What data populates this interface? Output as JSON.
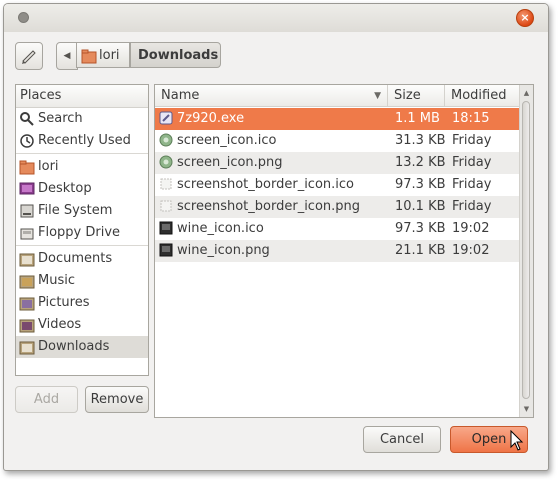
{
  "toolbar": {
    "breadcrumbs": [
      "lori",
      "Downloads"
    ]
  },
  "places": {
    "header": "Places",
    "items": [
      {
        "label": "Search",
        "icon": "search-icon"
      },
      {
        "label": "Recently Used",
        "icon": "clock-icon"
      },
      {
        "label": "lori",
        "icon": "home-folder-icon"
      },
      {
        "label": "Desktop",
        "icon": "desktop-icon"
      },
      {
        "label": "File System",
        "icon": "drive-icon"
      },
      {
        "label": "Floppy Drive",
        "icon": "floppy-icon"
      },
      {
        "label": "Documents",
        "icon": "folder-icon"
      },
      {
        "label": "Music",
        "icon": "folder-icon"
      },
      {
        "label": "Pictures",
        "icon": "folder-icon"
      },
      {
        "label": "Videos",
        "icon": "folder-icon"
      },
      {
        "label": "Downloads",
        "icon": "folder-icon"
      }
    ],
    "selected": "Downloads",
    "add_label": "Add",
    "remove_label": "Remove"
  },
  "files": {
    "columns": {
      "name": "Name",
      "size": "Size",
      "modified": "Modified"
    },
    "rows": [
      {
        "name": "7z920.exe",
        "size": "1.1 MB",
        "modified": "18:15"
      },
      {
        "name": "screen_icon.ico",
        "size": "31.3 KB",
        "modified": "Friday"
      },
      {
        "name": "screen_icon.png",
        "size": "13.2 KB",
        "modified": "Friday"
      },
      {
        "name": "screenshot_border_icon.ico",
        "size": "97.3 KB",
        "modified": "Friday"
      },
      {
        "name": "screenshot_border_icon.png",
        "size": "10.1 KB",
        "modified": "Friday"
      },
      {
        "name": "wine_icon.ico",
        "size": "97.3 KB",
        "modified": "19:02"
      },
      {
        "name": "wine_icon.png",
        "size": "21.1 KB",
        "modified": "19:02"
      }
    ],
    "selected_row": "7z920.exe"
  },
  "buttons": {
    "cancel_label": "Cancel",
    "open_label": "Open"
  },
  "colors": {
    "accent": "#ef7a49",
    "window_bg": "#f2f1f0"
  }
}
